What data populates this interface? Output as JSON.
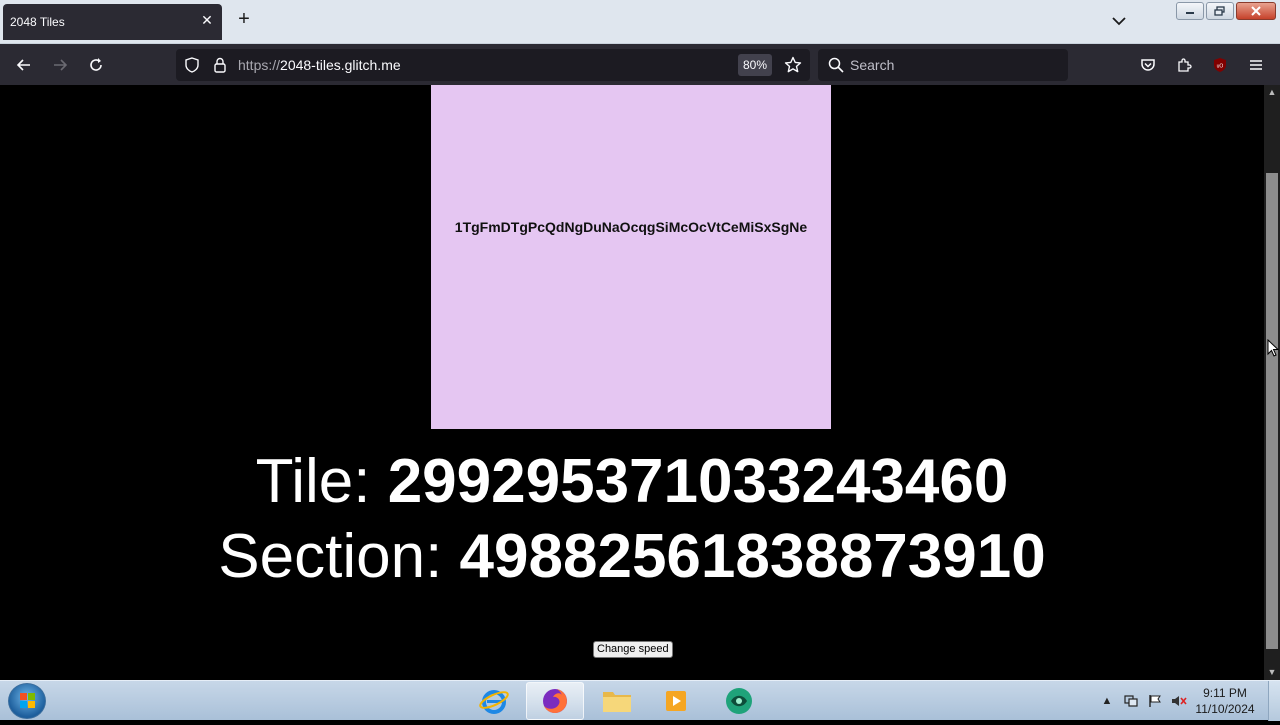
{
  "browser": {
    "tab": {
      "title": "2048 Tiles",
      "close": "✕"
    },
    "newtab": "+",
    "url": {
      "scheme": "https://",
      "host": "2048-tiles.glitch.me"
    },
    "zoom": "80%",
    "search_placeholder": "Search"
  },
  "page": {
    "tile_code": "1TgFmDTgPcQdNgDuNaOcqgSiMcOcVtCeMiSxSgNe",
    "tile_label": "Tile: ",
    "tile_value": "2992953710332434 60",
    "section_label": "Section: ",
    "section_value": "4988256183887391 0",
    "change_speed": "Change speed",
    "tile_color": "#e5c6f2"
  },
  "taskbar": {
    "time": "9:11 PM",
    "date": "11/10/2024"
  }
}
